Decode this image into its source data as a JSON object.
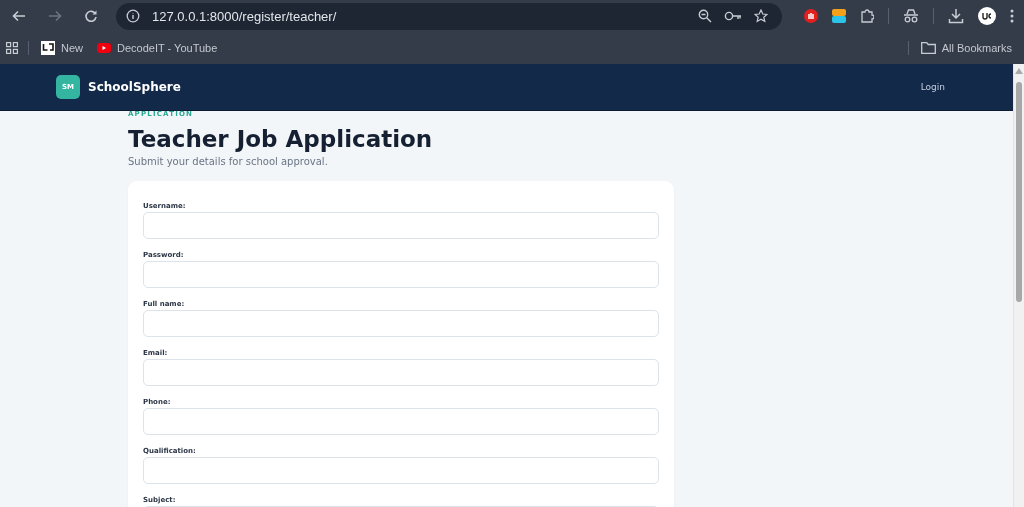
{
  "browser": {
    "url": "127.0.0.1:8000/register/teacher/",
    "bookmarks": [
      {
        "label": "New",
        "kind": "site"
      },
      {
        "label": "DecodeIT - YouTube",
        "kind": "video"
      }
    ],
    "all_bookmarks": "All Bookmarks"
  },
  "header": {
    "logo_badge": "SM",
    "brand": "SchoolSphere",
    "nav": [
      "Login"
    ]
  },
  "page": {
    "eyebrow": "APPLICATION",
    "title": "Teacher Job Application",
    "subtitle": "Submit your details for school approval."
  },
  "form": {
    "fields": [
      {
        "label": "Username:"
      },
      {
        "label": "Password:"
      },
      {
        "label": "Full name:"
      },
      {
        "label": "Email:"
      },
      {
        "label": "Phone:"
      },
      {
        "label": "Qualification:"
      },
      {
        "label": "Subject:"
      }
    ]
  }
}
